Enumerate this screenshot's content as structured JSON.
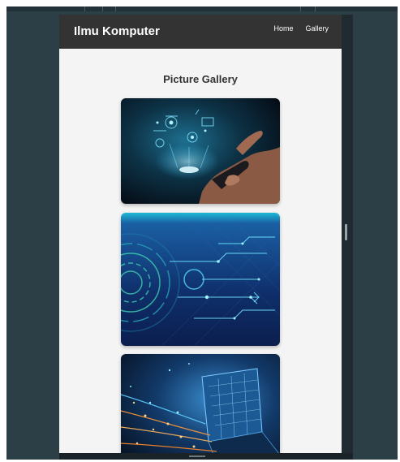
{
  "navbar": {
    "brand": "Ilmu Komputer",
    "links": [
      {
        "label": "Home"
      },
      {
        "label": "Gallery"
      }
    ],
    "background": "#333333"
  },
  "page": {
    "heading": "Picture Gallery",
    "background": "#f4f4f4"
  },
  "gallery": {
    "images": [
      {
        "subject": "hand holding smartphone with holographic icons",
        "icon": "hologram-phone-image"
      },
      {
        "subject": "blue circuit board with circular tech pattern",
        "icon": "circuit-image"
      },
      {
        "subject": "laptop with glowing fiber optic data lines",
        "icon": "laptop-data-image"
      }
    ]
  },
  "colors": {
    "workspace": "#2c3e46",
    "device_rail": "#1f2b30"
  }
}
